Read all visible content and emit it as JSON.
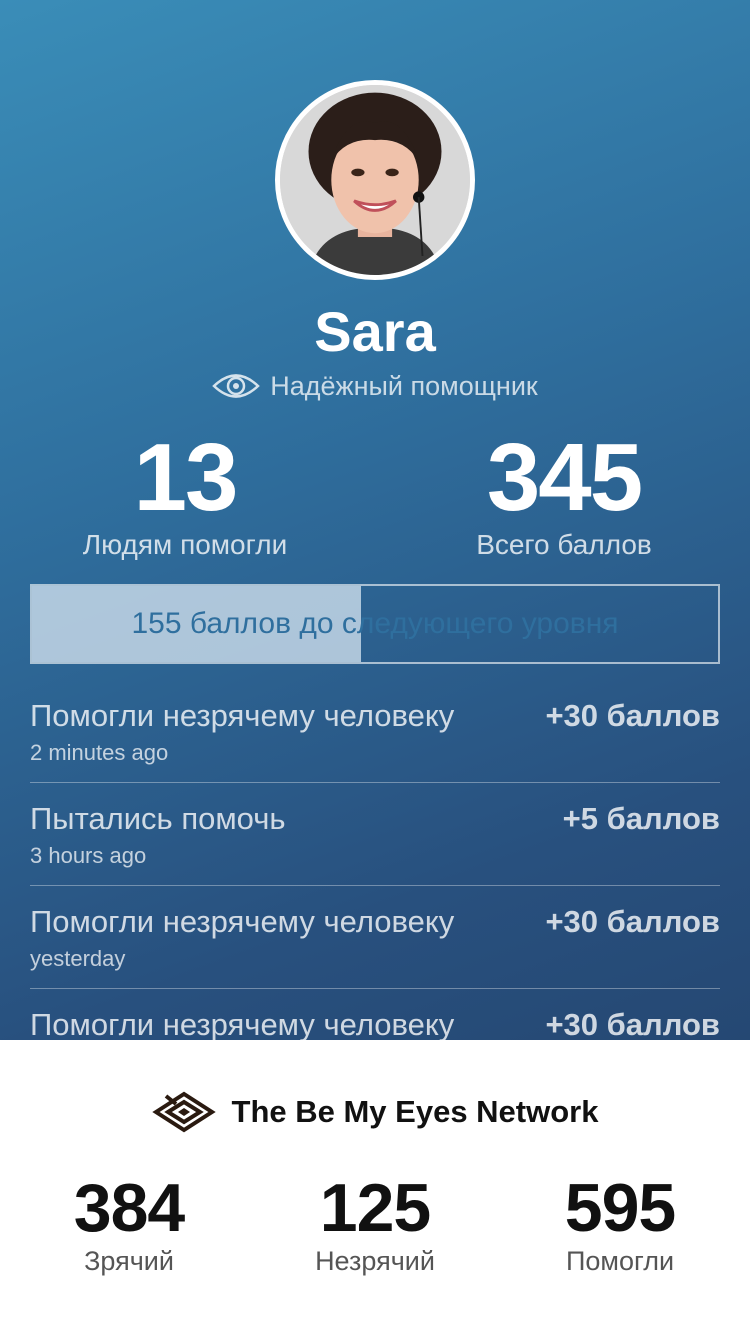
{
  "profile": {
    "name": "Sara",
    "badge_label": "Надёжный помощник",
    "badge_icon": "eye-icon"
  },
  "stats": {
    "helped": {
      "value": "13",
      "label": "Людям помогли"
    },
    "points": {
      "value": "345",
      "label": "Всего баллов"
    }
  },
  "progress": {
    "text": "155 баллов до следующего уровня",
    "fraction": 0.48
  },
  "feed": [
    {
      "title": "Помогли незрячему человеку",
      "time": "2 minutes ago",
      "points": "+30 баллов"
    },
    {
      "title": "Пытались помочь",
      "time": "3 hours ago",
      "points": "+5 баллов"
    },
    {
      "title": "Помогли незрячему человеку",
      "time": "yesterday",
      "points": "+30 баллов"
    },
    {
      "title": "Помогли незрячему человеку",
      "time": "",
      "points": "+30 баллов"
    }
  ],
  "network": {
    "title": "The Be My Eyes Network",
    "logo_icon": "be-my-eyes-logo-icon",
    "sighted": {
      "value": "384",
      "label": "Зрячий"
    },
    "blind": {
      "value": "125",
      "label": "Незрячий"
    },
    "helped": {
      "value": "595",
      "label": "Помогли"
    }
  },
  "colors": {
    "gradient_top": "#3a8db8",
    "gradient_bottom": "#254873",
    "progress_fill": "#d2e2ee",
    "progress_text": "#2f6f9e"
  }
}
